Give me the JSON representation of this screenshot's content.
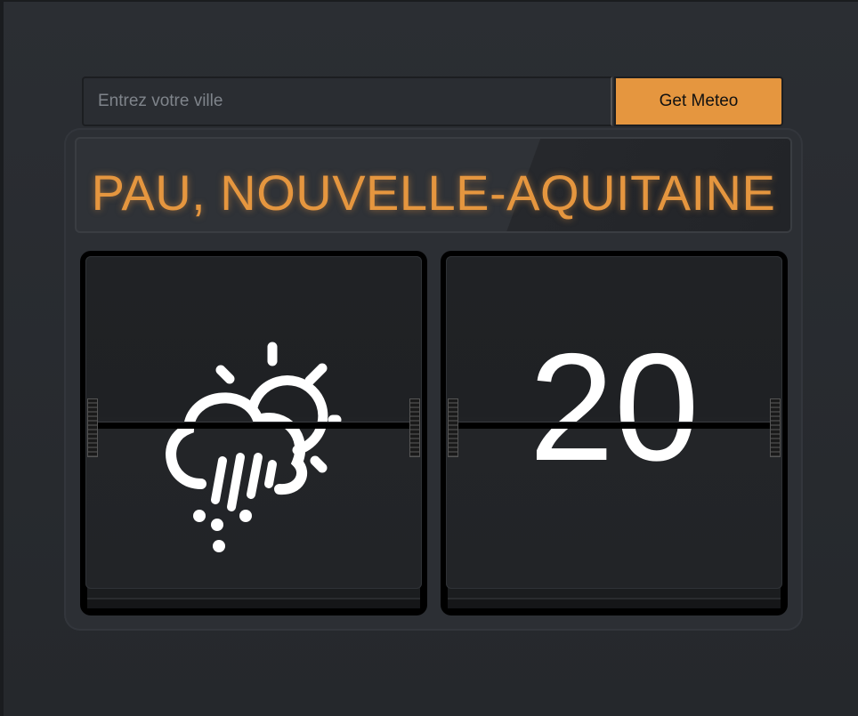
{
  "search": {
    "placeholder": "Entrez votre ville",
    "value": "",
    "button_label": "Get Meteo"
  },
  "location": {
    "title": "PAU, NOUVELLE-AQUITAINE"
  },
  "weather": {
    "icon": "sun-cloud-rain-icon",
    "temperature": "20"
  },
  "colors": {
    "accent": "#e5963f",
    "background": "#2b2e33",
    "flap": "#202225"
  }
}
